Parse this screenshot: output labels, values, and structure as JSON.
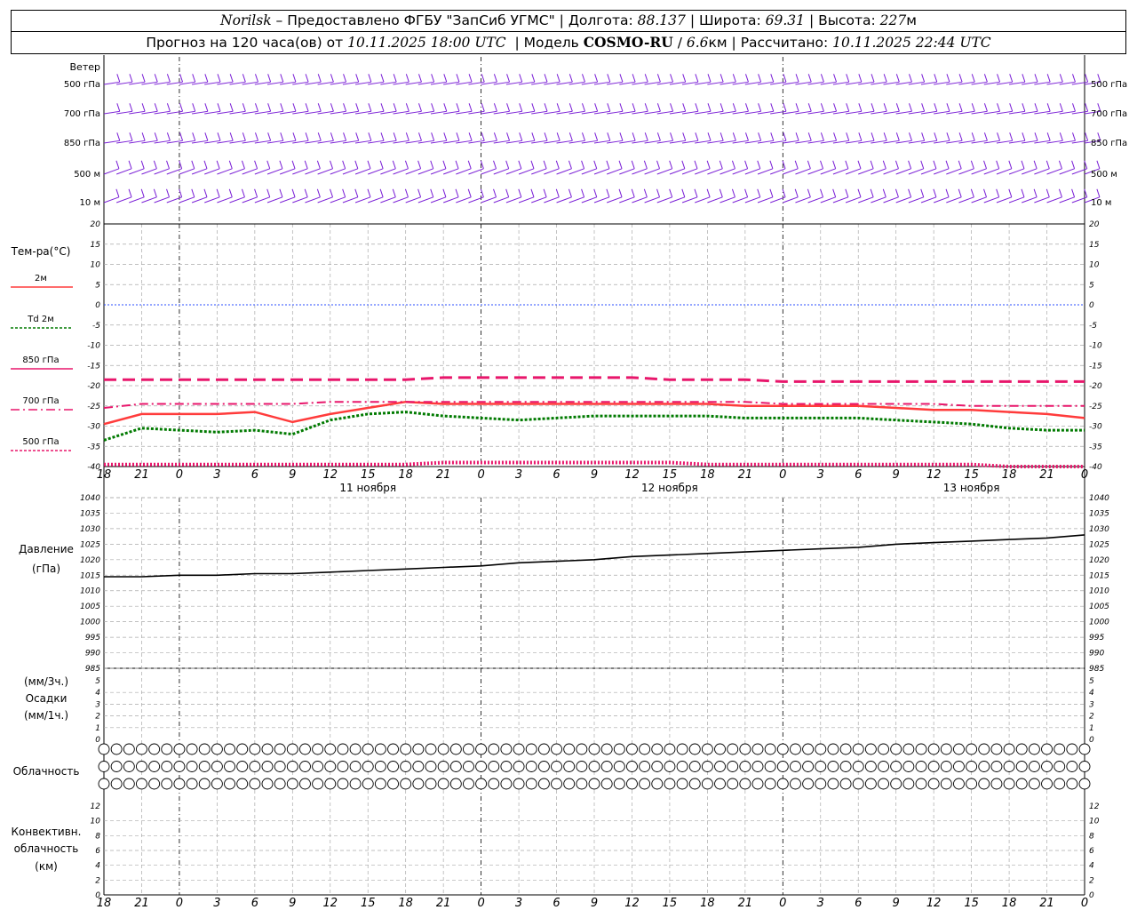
{
  "header": {
    "station": "Norilsk",
    "dash": "–",
    "provider": "Предоставлено ФГБУ \"ЗапСиб УГМС\"",
    "lon_label": "Долгота:",
    "lon_value": "88.137",
    "lat_label": "Широта:",
    "lat_value": "69.31",
    "alt_label": "Высота:",
    "alt_value": "227",
    "alt_unit": "м",
    "forecast_prefix": "Прогноз на 120 часа(ов) от",
    "forecast_time": "10.11.2025 18:00 UTC",
    "model_label": "Модель",
    "model_name": "COSMO-RU",
    "model_res": "6.6",
    "model_res_unit": "км",
    "computed_label": "Рассчитано:",
    "computed_time": "10.11.2025 22:44 UTC"
  },
  "labels": {
    "wind_title": "Ветер",
    "wind_levels": [
      "500 гПа",
      "700 гПа",
      "850 гПа",
      "500 м",
      "10  м"
    ],
    "temp_title": "Тем-ра(°C)",
    "temp_legend": [
      "2м",
      "Td  2м",
      "850 гПа",
      "700 гПа",
      "500 гПа"
    ],
    "pressure_title": "Давление",
    "pressure_unit": "(гПа)",
    "precip_unit_top": "(мм/3ч.)",
    "precip_title": "Осадки",
    "precip_unit_bottom": "(мм/1ч.)",
    "cloud_title": "Облачность",
    "conv_title_1": "Конвективн.",
    "conv_title_2": "облачность",
    "conv_unit": "(км)"
  },
  "chart_data": [
    {
      "type": "line",
      "title": "Тем-ра(°C)",
      "x_hours": [
        0,
        3,
        6,
        9,
        12,
        15,
        18,
        21,
        24,
        27,
        30,
        33,
        36,
        39,
        42,
        45,
        48,
        51,
        54,
        57,
        60,
        63,
        66,
        69,
        72,
        75,
        78
      ],
      "x_tick_labels": [
        "18",
        "21",
        "0",
        "3",
        "6",
        "9",
        "12",
        "15",
        "18",
        "21",
        "0",
        "3",
        "6",
        "9",
        "12",
        "15",
        "18",
        "21",
        "0",
        "3",
        "6",
        "9",
        "12",
        "15",
        "18",
        "21",
        "0"
      ],
      "day_labels": [
        "11 ноября",
        "12 ноября",
        "13 ноября"
      ],
      "ylim": [
        -40,
        20
      ],
      "yticks": [
        20,
        15,
        10,
        5,
        0,
        -5,
        -10,
        -15,
        -20,
        -25,
        -30,
        -35,
        -40
      ],
      "series": [
        {
          "name": "2м",
          "color": "#ff3b3b",
          "values": [
            -29.5,
            -27,
            -27,
            -27,
            -26.5,
            -29,
            -27,
            -25.5,
            -24,
            -24.5,
            -24.5,
            -24.5,
            -24.5,
            -24.5,
            -24.5,
            -24.5,
            -24.5,
            -25,
            -25,
            -25,
            -25,
            -25.5,
            -26,
            -26,
            -26.5,
            -27,
            -28
          ]
        },
        {
          "name": "Td  2м",
          "color": "#007a00",
          "values": [
            -33.5,
            -30.5,
            -31,
            -31.5,
            -31,
            -32,
            -28.5,
            -27,
            -26.5,
            -27.5,
            -28,
            -28.5,
            -28,
            -27.5,
            -27.5,
            -27.5,
            -27.5,
            -28,
            -28,
            -28,
            -28,
            -28.5,
            -29,
            -29.5,
            -30.5,
            -31,
            -31
          ]
        },
        {
          "name": "850 гПа",
          "color": "#e8166b",
          "values": [
            -18.5,
            -18.5,
            -18.5,
            -18.5,
            -18.5,
            -18.5,
            -18.5,
            -18.5,
            -18.5,
            -18,
            -18,
            -18,
            -18,
            -18,
            -18,
            -18.5,
            -18.5,
            -18.5,
            -19,
            -19,
            -19,
            -19,
            -19,
            -19,
            -19,
            -19,
            -19
          ]
        },
        {
          "name": "700 гПа",
          "color": "#e8166b",
          "values": [
            -25.5,
            -24.5,
            -24.5,
            -24.5,
            -24.5,
            -24.5,
            -24,
            -24,
            -24,
            -24,
            -24,
            -24,
            -24,
            -24,
            -24,
            -24,
            -24,
            -24,
            -24.5,
            -24.5,
            -24.5,
            -24.5,
            -24.5,
            -25,
            -25,
            -25,
            -25
          ]
        },
        {
          "name": "500 гПа",
          "color": "#e8166b",
          "values": [
            -39.5,
            -39.5,
            -39.5,
            -39.5,
            -39.5,
            -39.5,
            -39.5,
            -39.5,
            -39.5,
            -39,
            -39,
            -39,
            -39,
            -39,
            -39,
            -39,
            -39.5,
            -39.5,
            -39.5,
            -39.5,
            -39.5,
            -39.5,
            -39.5,
            -39.5,
            -40,
            -40,
            -40
          ]
        }
      ]
    },
    {
      "type": "line",
      "title": "Давление",
      "ylabel": "(гПа)",
      "ylim": [
        985,
        1040
      ],
      "yticks": [
        1040,
        1035,
        1030,
        1025,
        1020,
        1015,
        1010,
        1005,
        1000,
        995,
        990,
        985
      ],
      "series": [
        {
          "name": "",
          "color": "#000000",
          "values": [
            1014.5,
            1014.5,
            1015,
            1015,
            1015.5,
            1015.5,
            1016,
            1016.5,
            1017,
            1017.5,
            1018,
            1019,
            1019.5,
            1020,
            1021,
            1021.5,
            1022,
            1022.5,
            1023,
            1023.5,
            1024,
            1025,
            1025.5,
            1026,
            1026.5,
            1027,
            1028
          ]
        }
      ]
    },
    {
      "type": "bar",
      "title": "Осадки",
      "ylim": [
        0,
        5
      ],
      "yticks": [
        5,
        4,
        3,
        2,
        1,
        0
      ],
      "values": []
    },
    {
      "type": "bar",
      "title": "Конвективн. облачность",
      "ylabel": "(км)",
      "ylim": [
        0,
        12
      ],
      "yticks": [
        12,
        10,
        8,
        6,
        4,
        2,
        0
      ],
      "values": []
    }
  ]
}
